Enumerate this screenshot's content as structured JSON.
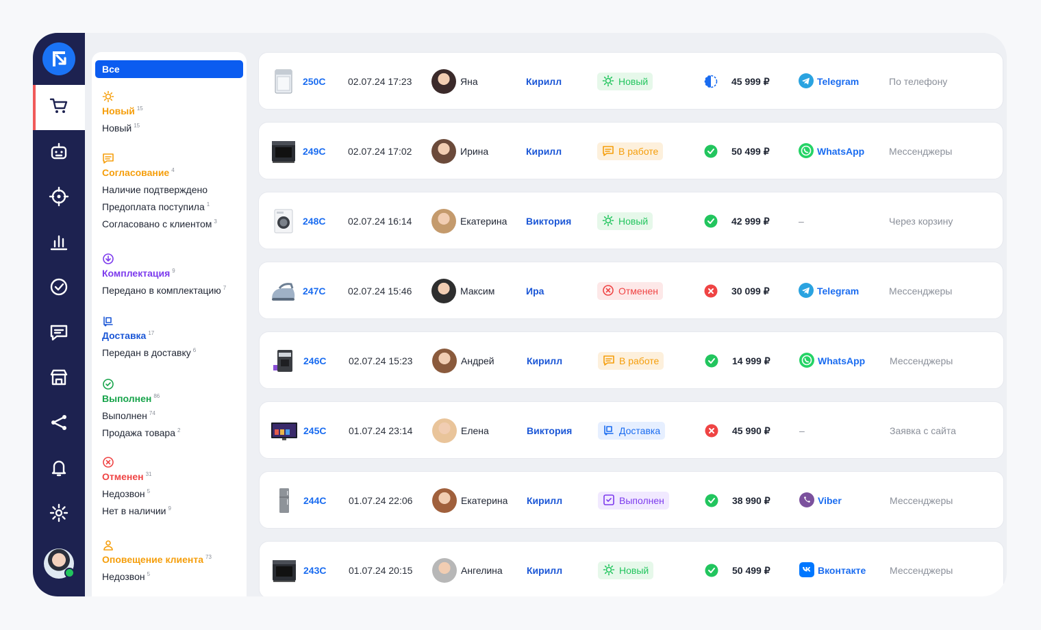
{
  "logo": {
    "icon": "r-arrow-logo-icon",
    "color": "#1a73f5"
  },
  "colors": {
    "rail": "#1d2250",
    "accent": "#0b5cf0",
    "orange": "#f59e0b",
    "green": "#22c55e",
    "red": "#ef4444",
    "purple": "#7c3aed",
    "blue": "#1a56d6"
  },
  "nav": {
    "items": [
      {
        "icon": "cart-icon",
        "active": true
      },
      {
        "icon": "bot-icon"
      },
      {
        "icon": "target-icon"
      },
      {
        "icon": "bar-chart-icon"
      },
      {
        "icon": "check-circle-icon"
      },
      {
        "icon": "chat-icon"
      },
      {
        "icon": "store-icon"
      },
      {
        "icon": "share-icon"
      },
      {
        "icon": "bell-icon"
      },
      {
        "icon": "gear-icon"
      }
    ]
  },
  "filters": {
    "all_label": "Все",
    "groups": [
      {
        "title": "Новый",
        "count": "15",
        "color": "#f59e0b",
        "icon": "sun-icon",
        "subs": [
          {
            "label": "Новый",
            "count": "15"
          }
        ]
      },
      {
        "title": "Согласование",
        "count": "4",
        "color": "#f59e0b",
        "icon": "message-icon",
        "subs": [
          {
            "label": "Наличие подтверждено",
            "count": ""
          },
          {
            "label": "Предоплата поступила",
            "count": "1"
          },
          {
            "label": "Согласовано с клиентом",
            "count": "3"
          }
        ]
      },
      {
        "title": "Комплектация",
        "count": "9",
        "color": "#7c3aed",
        "icon": "download-circle-icon",
        "subs": [
          {
            "label": "Передано в комплектацию",
            "count": "7"
          }
        ]
      },
      {
        "title": "Доставка",
        "count": "17",
        "color": "#1a56d6",
        "icon": "delivery-icon",
        "subs": [
          {
            "label": "Передан в доставку",
            "count": "6"
          }
        ]
      },
      {
        "title": "Выполнен",
        "count": "86",
        "color": "#16a34a",
        "icon": "check-circle-icon",
        "subs": [
          {
            "label": "Выполнен",
            "count": "74"
          },
          {
            "label": "Продажа товара",
            "count": "2"
          }
        ]
      },
      {
        "title": "Отменен",
        "count": "31",
        "color": "#ef4444",
        "icon": "x-circle-icon",
        "subs": [
          {
            "label": "Недозвон",
            "count": "5"
          },
          {
            "label": "Нет в наличии",
            "count": "9"
          }
        ]
      },
      {
        "title": "Оповещение клиента",
        "count": "73",
        "color": "#f59e0b",
        "icon": "user-icon",
        "subs": [
          {
            "label": "Недозвон",
            "count": "5"
          }
        ]
      }
    ]
  },
  "orders": [
    {
      "id": "250С",
      "date": "02.07.24 17:23",
      "client": "Яна",
      "manager": "Кирилл",
      "status": "Новый",
      "status_kind": "new",
      "payment": "partial",
      "price": "45 999 ₽",
      "channel": "Telegram",
      "channel_kind": "telegram",
      "source": "По телефону",
      "product": "dishwasher"
    },
    {
      "id": "249С",
      "date": "02.07.24 17:02",
      "client": "Ирина",
      "manager": "Кирилл",
      "status": "В работе",
      "status_kind": "work",
      "payment": "paid",
      "price": "50 499 ₽",
      "channel": "WhatsApp",
      "channel_kind": "whatsapp",
      "source": "Мессенджеры",
      "product": "oven"
    },
    {
      "id": "248С",
      "date": "02.07.24 16:14",
      "client": "Екатерина",
      "manager": "Виктория",
      "status": "Новый",
      "status_kind": "new",
      "payment": "paid",
      "price": "42 999 ₽",
      "channel": "–",
      "channel_kind": "none",
      "source": "Через корзину",
      "product": "washer"
    },
    {
      "id": "247С",
      "date": "02.07.24 15:46",
      "client": "Максим",
      "manager": "Ира",
      "status": "Отменен",
      "status_kind": "cancel",
      "payment": "failed",
      "price": "30 099 ₽",
      "channel": "Telegram",
      "channel_kind": "telegram",
      "source": "Мессенджеры",
      "product": "iron"
    },
    {
      "id": "246С",
      "date": "02.07.24 15:23",
      "client": "Андрей",
      "manager": "Кирилл",
      "status": "В работе",
      "status_kind": "work",
      "payment": "paid",
      "price": "14 999 ₽",
      "channel": "WhatsApp",
      "channel_kind": "whatsapp",
      "source": "Мессенджеры",
      "product": "coffee"
    },
    {
      "id": "245С",
      "date": "01.07.24 23:14",
      "client": "Елена",
      "manager": "Виктория",
      "status": "Доставка",
      "status_kind": "delivery",
      "payment": "failed",
      "price": "45 990 ₽",
      "channel": "–",
      "channel_kind": "none",
      "source": "Заявка с сайта",
      "product": "tv"
    },
    {
      "id": "244С",
      "date": "01.07.24 22:06",
      "client": "Екатерина",
      "manager": "Кирилл",
      "status": "Выполнен",
      "status_kind": "done",
      "payment": "paid",
      "price": "38 990 ₽",
      "channel": "Viber",
      "channel_kind": "viber",
      "source": "Мессенджеры",
      "product": "fridge"
    },
    {
      "id": "243С",
      "date": "01.07.24 20:15",
      "client": "Ангелина",
      "manager": "Кирилл",
      "status": "Новый",
      "status_kind": "new",
      "payment": "paid",
      "price": "50 499 ₽",
      "channel": "Вконтакте",
      "channel_kind": "vk",
      "source": "Мессенджеры",
      "product": "oven"
    }
  ]
}
